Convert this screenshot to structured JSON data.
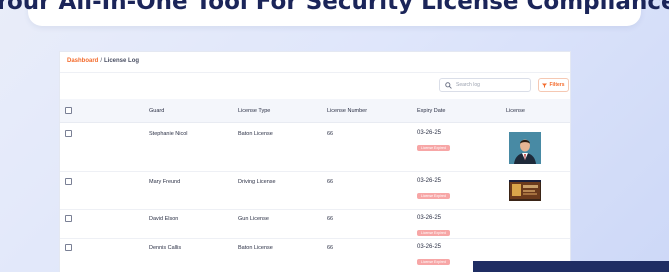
{
  "banner": {
    "title": "Your All-In-One Tool For Security License Compliance"
  },
  "breadcrumb": {
    "root": "Dashboard",
    "separator": "/",
    "current": "License Log"
  },
  "toolbar": {
    "search_placeholder": "Search log",
    "filters_label": "Filters"
  },
  "table": {
    "headers": {
      "guard": "Guard",
      "license_type": "License Type",
      "license_number": "License Number",
      "expiry_date": "Expiry Date",
      "license": "License"
    },
    "rows": [
      {
        "guard": "Stephanie Nicol",
        "license_type": "Baton License",
        "license_number": "66",
        "expiry_date": "03-26-25",
        "status": "License Expired"
      },
      {
        "guard": "Mary Freund",
        "license_type": "Driving License",
        "license_number": "66",
        "expiry_date": "03-26-25",
        "status": "License Expired"
      },
      {
        "guard": "David Elson",
        "license_type": "Gun License",
        "license_number": "66",
        "expiry_date": "03-26-25",
        "status": "License Expired"
      },
      {
        "guard": "Dennis Callis",
        "license_type": "Baton License",
        "license_number": "66",
        "expiry_date": "03-26-25",
        "status": "License Expired"
      }
    ]
  },
  "colors": {
    "accent": "#f46b2c",
    "badge": "#f7a6a6",
    "title": "#1b2559",
    "header_bg": "#f4f6fb"
  }
}
